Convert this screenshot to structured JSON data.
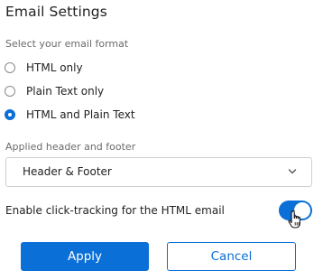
{
  "title": "Email Settings",
  "format": {
    "label": "Select your email format",
    "options": [
      {
        "label": "HTML only",
        "selected": false
      },
      {
        "label": "Plain Text only",
        "selected": false
      },
      {
        "label": "HTML and Plain Text",
        "selected": true
      }
    ]
  },
  "header_footer": {
    "label": "Applied header and footer",
    "selected_value": "Header & Footer",
    "icon": "chevron-down-icon"
  },
  "click_tracking": {
    "label": "Enable click-tracking for the HTML email",
    "enabled": true
  },
  "buttons": {
    "apply_label": "Apply",
    "cancel_label": "Cancel"
  },
  "colors": {
    "accent": "#0a6fd6",
    "text": "#222222",
    "muted": "#6b6b6b",
    "border": "#cfcfcf"
  }
}
